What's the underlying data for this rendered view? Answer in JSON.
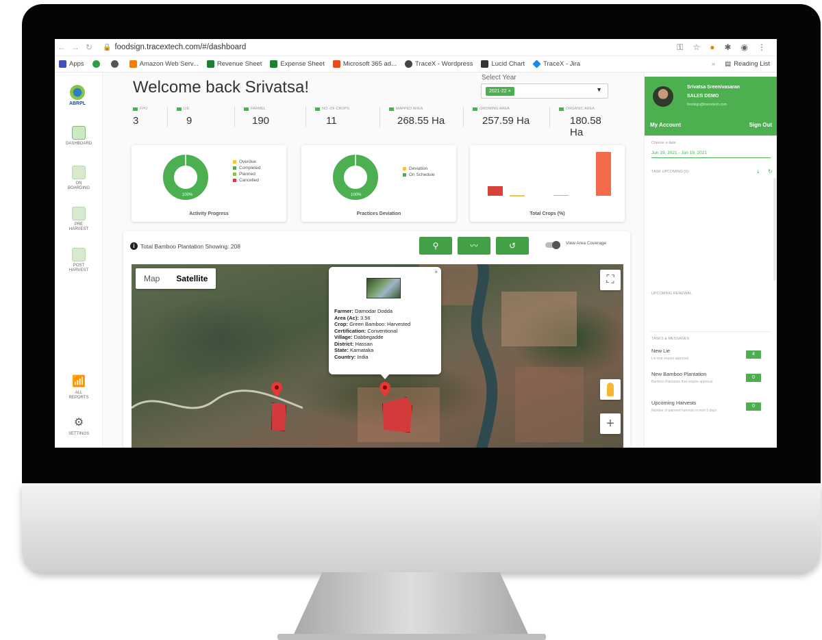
{
  "browser": {
    "url": "foodsign.tracextech.com/#/dashboard",
    "bookmarks": [
      "Apps",
      "Amazon Web Serv...",
      "Revenue Sheet",
      "Expense Sheet",
      "Microsoft 365 ad...",
      "TraceX - Wordpress",
      "Lucid Chart",
      "TraceX - Jira"
    ],
    "reading_list": "Reading List"
  },
  "sidebar": {
    "logo_text": "ABRPL",
    "items": [
      "DASHBOARD",
      "ON BOARDING",
      "PRE HARVEST",
      "POST HARVEST",
      "ALL REPORTS",
      "SETTINGS"
    ]
  },
  "header": {
    "welcome": "Welcome back Srivatsa!",
    "year_label": "Select Year",
    "year_value": "2021-22"
  },
  "stats": [
    {
      "label": "FPO",
      "value": "3"
    },
    {
      "label": "LIE",
      "value": "9"
    },
    {
      "label": "FARMEL",
      "value": "190"
    },
    {
      "label": "NO. OF CROPS",
      "value": "11"
    },
    {
      "label": "MAPPED AREA",
      "value": "268.55 Ha"
    },
    {
      "label": "GROWING AREA",
      "value": "257.59 Ha"
    },
    {
      "label": "ORGANIC AREA",
      "value": "180.58 Ha"
    }
  ],
  "cards": {
    "activity": {
      "title": "Activity Progress",
      "percent_label": "100%",
      "legend": [
        "Overdue",
        "Completed",
        "Planned",
        "Cancelled"
      ]
    },
    "deviation": {
      "title": "Practices Deviation",
      "percent_label": "100%",
      "legend": [
        "Deviation",
        "On Schedule"
      ]
    },
    "crops": {
      "title": "Total Crops (%)"
    }
  },
  "colors": {
    "accent": "#4caf50",
    "overdue": "#f5c242",
    "completed": "#4caf50",
    "planned": "#8bc34a",
    "cancelled": "#e53935",
    "bar_red": "#d84339",
    "bar_orange": "#f26a4a"
  },
  "map_section": {
    "count_text": "Total Bamboo Plantation Showing: 208",
    "toggle_label": "View Area Coverage",
    "map_type_map": "Map",
    "map_type_satellite": "Satellite",
    "icons": [
      "search-icon",
      "chart-line-icon",
      "history-icon"
    ],
    "popup": {
      "farmer_label": "Farmer:",
      "farmer": "Damodar Dodda",
      "area_label": "Area (Ac):",
      "area": "3.56",
      "crop_label": "Crop:",
      "crop": "Green Bamboo: Harvested",
      "cert_label": "Certification:",
      "cert": "Conventional",
      "village_label": "Village:",
      "village": "Dabbegadde",
      "district_label": "District:",
      "district": "Hassan",
      "state_label": "State:",
      "state": "Karnataka",
      "country_label": "Country:",
      "country": "India",
      "close": "×"
    }
  },
  "right_panel": {
    "name": "Srivatsa Sreenivasaran",
    "role": "SALES DEMO",
    "email": "foodsign@tracextech.com",
    "my_account": "My Account",
    "sign_out": "Sign Out",
    "date_label": "Choose a date",
    "date_range": "Jun 19, 2021 - Jun 19, 2021",
    "task_upcoming": "TASK UPCOMING (0)",
    "upcoming_renewal": "UPCOMING RENEWAL",
    "tasks_heading": "TASKS & MESSAGES",
    "tasks": [
      {
        "title": "New Lie",
        "sub": "Lie that require approval",
        "count": "4"
      },
      {
        "title": "New Bamboo Plantation",
        "sub": "Bamboo Plantation that require approval",
        "count": "0"
      },
      {
        "title": "Upcoming Harvests",
        "sub": "Number of planned harvests in next 5 days",
        "count": "0"
      }
    ]
  }
}
